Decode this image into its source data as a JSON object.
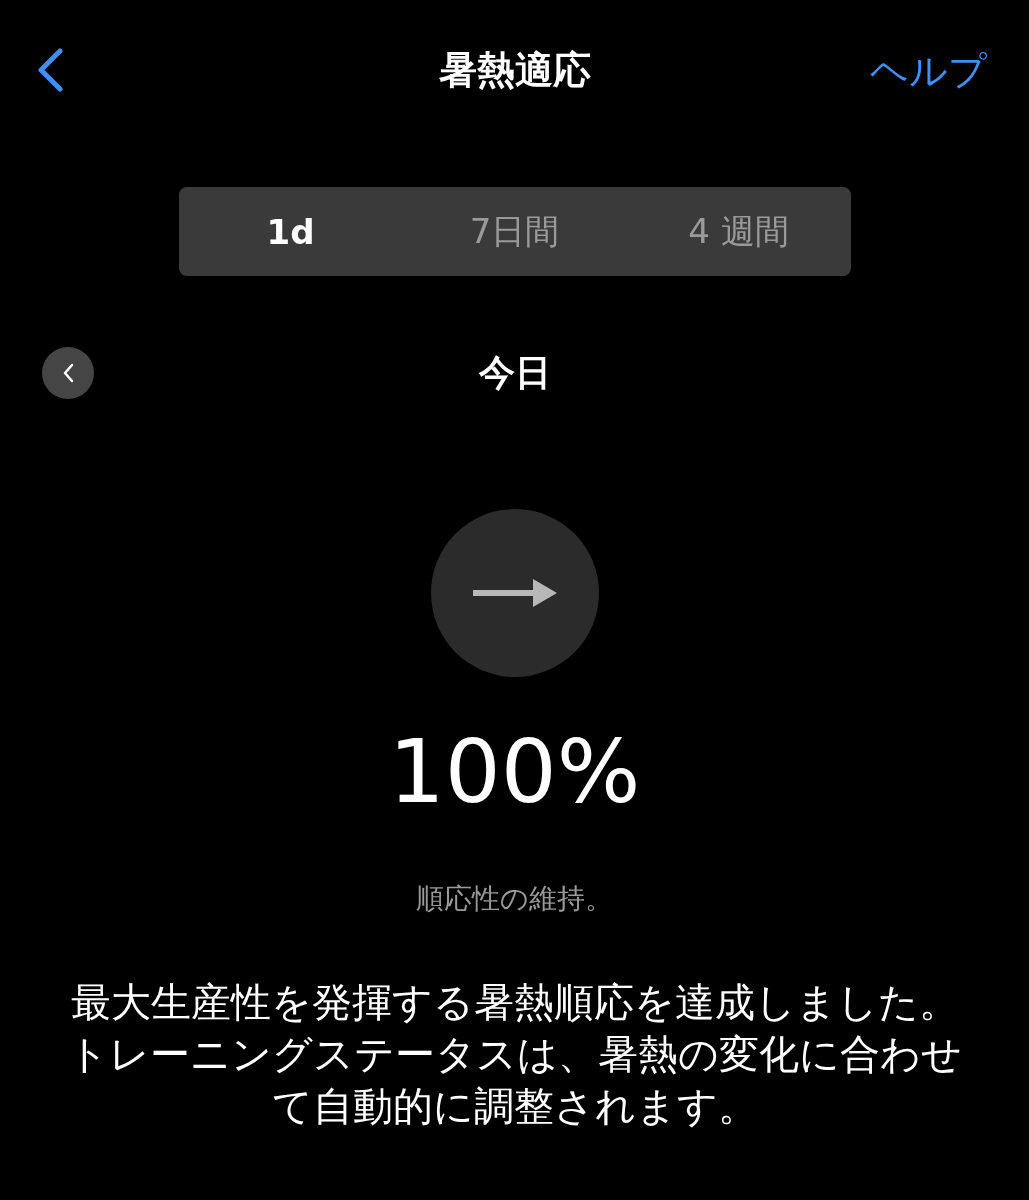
{
  "header": {
    "title": "暑熱適応",
    "help": "ヘルプ"
  },
  "tabs": [
    {
      "label": "1d",
      "selected": true
    },
    {
      "label": "7日間",
      "selected": false
    },
    {
      "label": "4 週間",
      "selected": false
    }
  ],
  "date_nav": {
    "label": "今日"
  },
  "acclimation": {
    "value": "100%",
    "status": "順応性の維持。"
  },
  "description": "最大生産性を発揮する暑熱順応を達成しました。トレーニングステータスは、暑熱の変化に合わせて自動的に調整されます。"
}
